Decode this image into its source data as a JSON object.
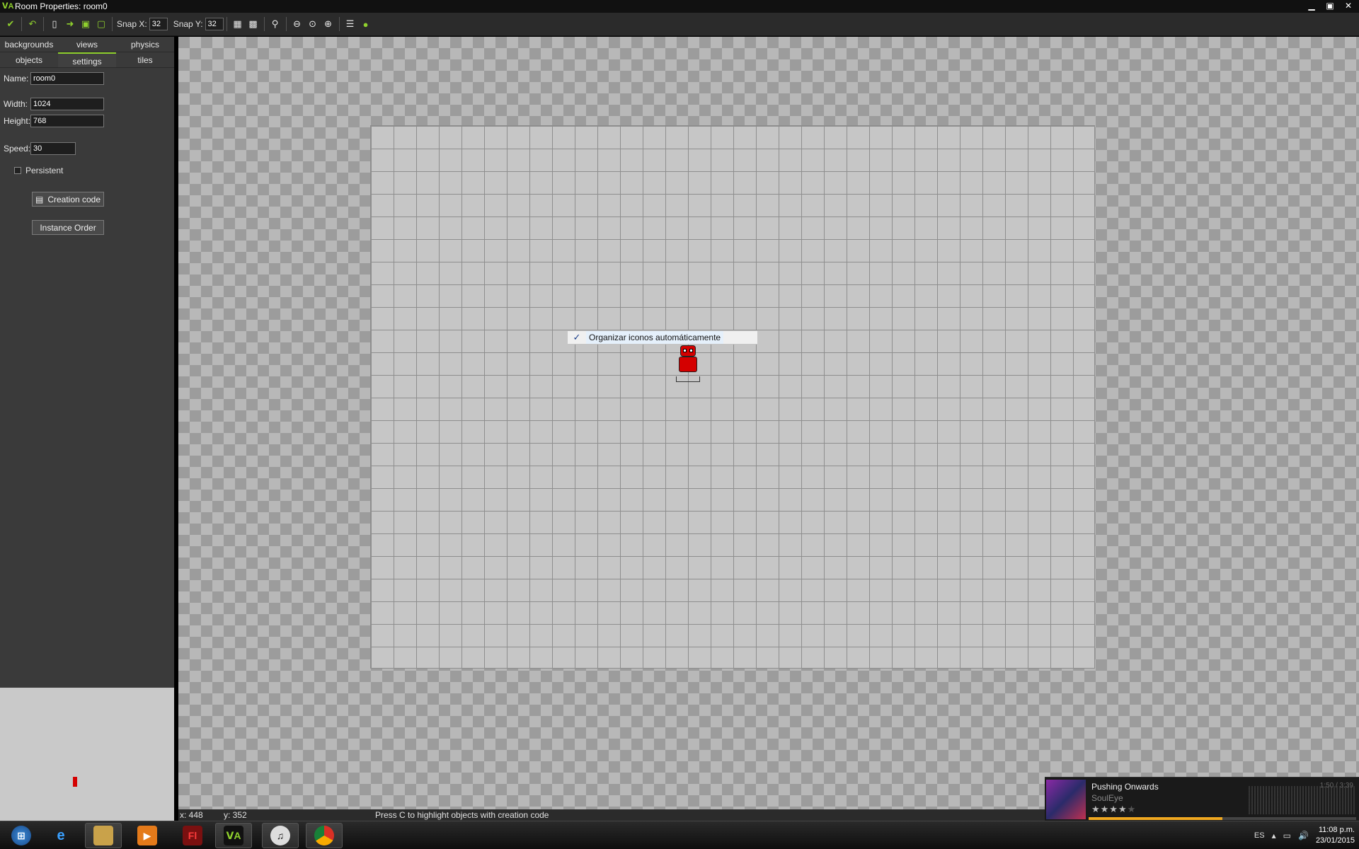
{
  "window": {
    "title": "Room Properties: room0"
  },
  "toolbar": {
    "snap_x_label": "Snap X:",
    "snap_x_value": "32",
    "snap_y_label": "Snap Y:",
    "snap_y_value": "32"
  },
  "tabs": {
    "row1": [
      "backgrounds",
      "views",
      "physics"
    ],
    "row2": [
      "objects",
      "settings",
      "tiles"
    ],
    "active": "settings"
  },
  "settings": {
    "name_label": "Name:",
    "name_value": "room0",
    "width_label": "Width:",
    "width_value": "1024",
    "height_label": "Height:",
    "height_value": "768",
    "speed_label": "Speed:",
    "speed_value": "30",
    "persistent_label": "Persistent",
    "persistent_checked": false,
    "creation_code_label": "Creation code",
    "instance_order_label": "Instance Order"
  },
  "context_menu": {
    "item_label": "Organizar iconos automáticamente",
    "item_checked": true
  },
  "statusbar": {
    "x": "x: 448",
    "y": "y: 352",
    "hint": "Press C to highlight objects with creation code"
  },
  "media": {
    "song": "Pushing Onwards",
    "artist": "SoulEye",
    "time": "1:50 / 3:39",
    "rating_stars": 4,
    "progress": 0.5
  },
  "taskbar": {
    "apps": [
      "start-button",
      "internet-explorer",
      "file-explorer",
      "media-player",
      "flash",
      "gamemaker",
      "itunes",
      "chrome"
    ],
    "language": "ES",
    "time": "11:08 p.m.",
    "date": "23/01/2015"
  },
  "colors": {
    "accent": "#8fd02d",
    "panel": "#3a3a3a",
    "room_bg": "#c6c6c6",
    "instance": "#d40000"
  }
}
